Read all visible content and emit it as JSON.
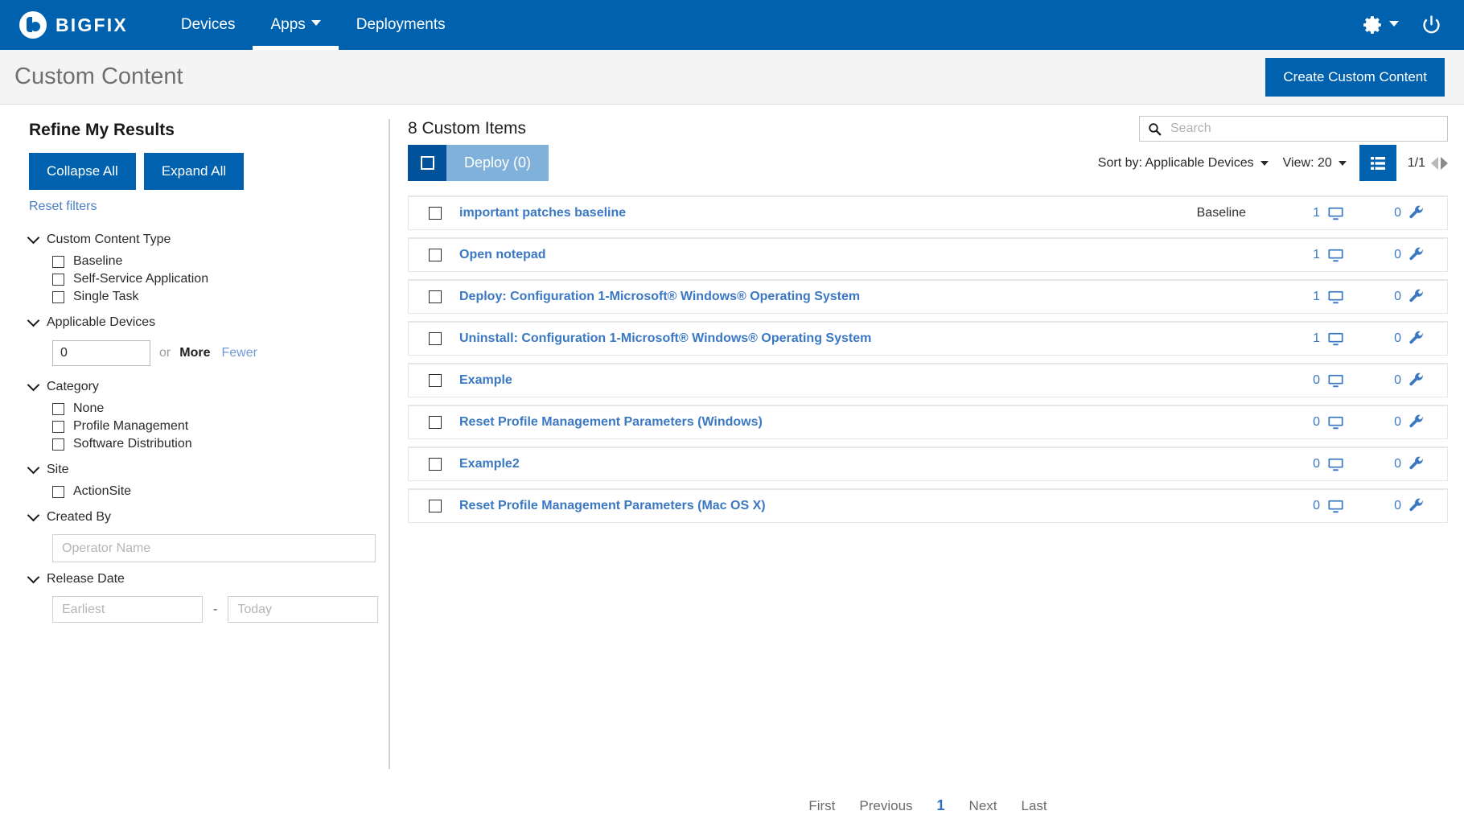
{
  "topnav": {
    "brand": "BIGFIX",
    "items": [
      {
        "label": "Devices",
        "active": false
      },
      {
        "label": "Apps",
        "active": true
      },
      {
        "label": "Deployments",
        "active": false
      }
    ],
    "settings_icon": "gear-icon",
    "power_icon": "power-icon"
  },
  "pageheader": {
    "title": "Custom Content",
    "create_button": "Create Custom Content"
  },
  "sidebar": {
    "heading": "Refine My Results",
    "collapse_all": "Collapse All",
    "expand_all": "Expand All",
    "reset_filters": "Reset filters",
    "groups": {
      "content_type": {
        "label": "Custom Content Type",
        "options": [
          "Baseline",
          "Self-Service Application",
          "Single Task"
        ]
      },
      "applicable_devices": {
        "label": "Applicable Devices",
        "value": "0",
        "or": "or",
        "more": "More",
        "fewer": "Fewer"
      },
      "category": {
        "label": "Category",
        "options": [
          "None",
          "Profile Management",
          "Software Distribution"
        ]
      },
      "site": {
        "label": "Site",
        "options": [
          "ActionSite"
        ]
      },
      "created_by": {
        "label": "Created By",
        "placeholder": "Operator Name",
        "value": ""
      },
      "release_date": {
        "label": "Release Date",
        "from_placeholder": "Earliest",
        "to_placeholder": "Today",
        "separator": "-",
        "from_value": "",
        "to_value": ""
      }
    }
  },
  "main": {
    "items_count": "8 Custom Items",
    "search": {
      "placeholder": "Search",
      "value": ""
    },
    "select_all": "select-all",
    "deploy_button": "Deploy (0)",
    "sort_by": "Sort by: Applicable Devices",
    "view": "View: 20",
    "page_indicator": "1/1",
    "rows": [
      {
        "title": "important patches baseline",
        "type": "Baseline",
        "devices": "1",
        "deployments": "0"
      },
      {
        "title": "Open notepad",
        "type": "",
        "devices": "1",
        "deployments": "0"
      },
      {
        "title": "Deploy: Configuration 1-Microsoft® Windows® Operating System",
        "type": "",
        "devices": "1",
        "deployments": "0"
      },
      {
        "title": "Uninstall: Configuration 1-Microsoft® Windows® Operating System",
        "type": "",
        "devices": "1",
        "deployments": "0"
      },
      {
        "title": "Example",
        "type": "",
        "devices": "0",
        "deployments": "0"
      },
      {
        "title": "Reset Profile Management Parameters (Windows)",
        "type": "",
        "devices": "0",
        "deployments": "0"
      },
      {
        "title": "Example2",
        "type": "",
        "devices": "0",
        "deployments": "0"
      },
      {
        "title": "Reset Profile Management Parameters (Mac OS X)",
        "type": "",
        "devices": "0",
        "deployments": "0"
      }
    ],
    "pagination": {
      "first": "First",
      "previous": "Previous",
      "current": "1",
      "next": "Next",
      "last": "Last"
    }
  },
  "colors": {
    "brand_blue": "#0062ae",
    "link_blue": "#3b78c3",
    "deploy_disabled": "#80b1db",
    "page_bg": "#f4f4f4"
  }
}
